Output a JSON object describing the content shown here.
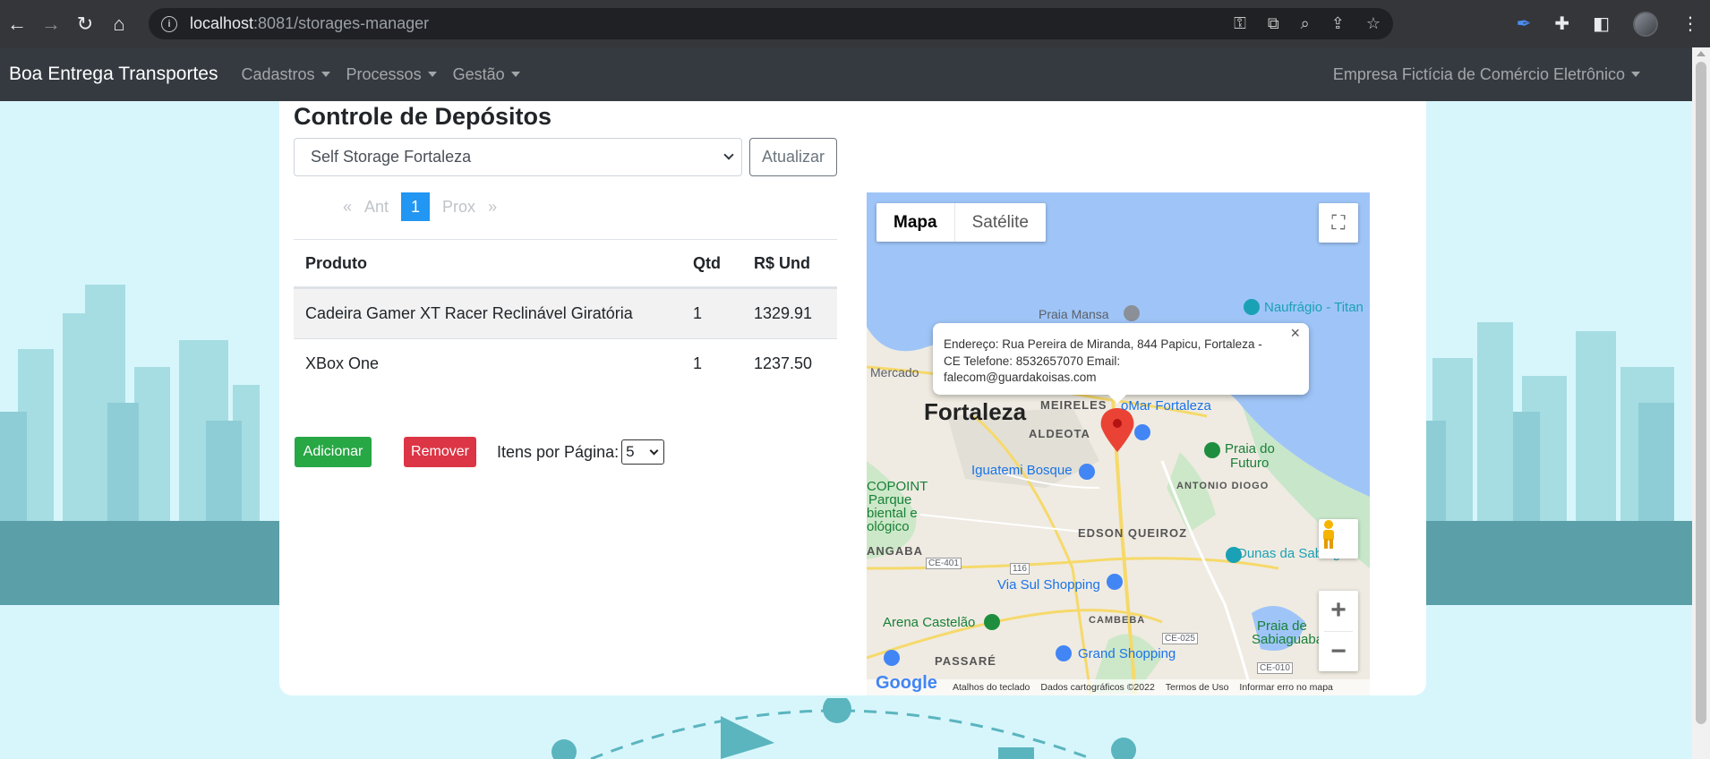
{
  "browser": {
    "url_host": "localhost",
    "url_rest": ":8081/storages-manager"
  },
  "navbar": {
    "brand": "Boa Entrega Transportes",
    "menus": [
      "Cadastros",
      "Processos",
      "Gestão"
    ],
    "company": "Empresa Fictícia de Comércio Eletrônico"
  },
  "main": {
    "title": "Controle de Depósitos",
    "storage_selected": "Self Storage Fortaleza",
    "refresh_label": "Atualizar",
    "pager": {
      "first": "«",
      "prev": "Ant",
      "current": "1",
      "next": "Prox",
      "last": "»"
    },
    "table": {
      "headers": [
        "Produto",
        "Qtd",
        "R$ Und"
      ],
      "rows": [
        {
          "product": "Cadeira Gamer XT Racer Reclinável Giratória",
          "qty": "1",
          "price": "1329.91"
        },
        {
          "product": "XBox One",
          "qty": "1",
          "price": "1237.50"
        }
      ]
    },
    "add_label": "Adicionar",
    "remove_label": "Remover",
    "per_page_label": "Itens por Página:",
    "per_page_value": "5"
  },
  "map": {
    "type_map": "Mapa",
    "type_satellite": "Satélite",
    "info_text": "Endereço: Rua Pereira de Miranda, 844 Papicu, Fortaleza - CE Telefone: 8532657070 Email: falecom@guardakoisas.com",
    "labels": {
      "city": "Fortaleza",
      "praia_mansa": "Praia Mansa",
      "naufragio": "Naufrágio - Titan",
      "mercado": "Mercado",
      "meireles": "MEIRELES",
      "aldeota": "ALDEOTA",
      "shopping_partial": "oMar Fortaleza",
      "praia_futuro_1": "Praia do",
      "praia_futuro_2": "Futuro",
      "iguatemi": "Iguatemi Bosque",
      "antonio_diogo": "ANTONIO DIOGO",
      "cocoparque_1": "COPOINT",
      "cocoparque_2": "Parque",
      "cocoparque_3": "biental e",
      "cocoparque_4": "ológico",
      "edson": "EDSON QUEIROZ",
      "angaba": "ANGABA",
      "ce401": "CE-401",
      "r116": "116",
      "dunas": "Dunas da Sabiagua",
      "via_sul": "Via Sul Shopping",
      "arena": "Arena Castelão",
      "cambeba": "CAMBEBA",
      "praia_sab_1": "Praia de",
      "praia_sab_2": "Sabiaguaba",
      "ce025": "CE-025",
      "grand": "Grand Shopping",
      "passare": "PASSARÉ",
      "ce010": "CE-010"
    },
    "footer": {
      "keyboard": "Atalhos do teclado",
      "data": "Dados cartográficos ©2022",
      "terms": "Termos de Uso",
      "report": "Informar erro no mapa"
    },
    "logo": "Google"
  },
  "colors": {
    "navbar": "#343a40",
    "primary": "#2196f3",
    "success": "#28a745",
    "danger": "#dc3545",
    "water": "#9fc5f8"
  }
}
